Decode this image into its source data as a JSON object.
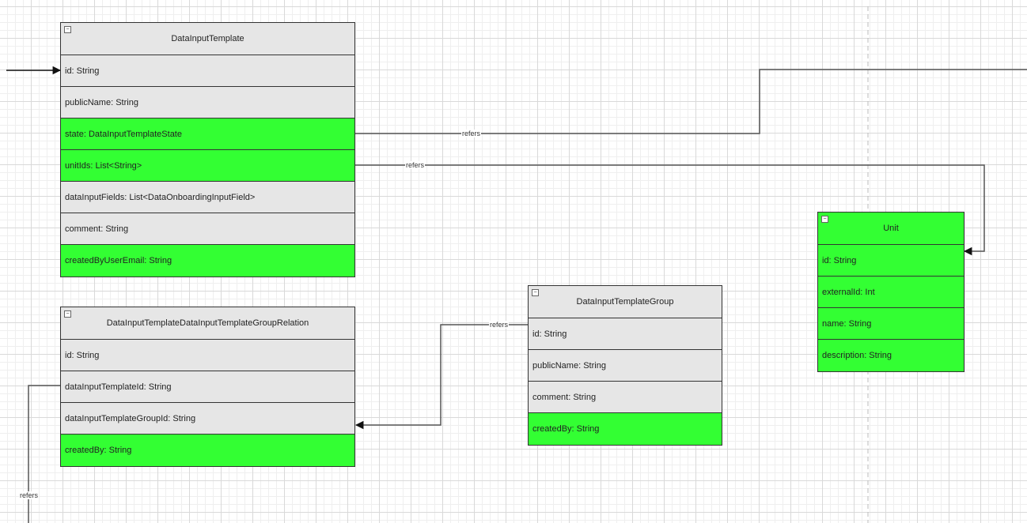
{
  "colors": {
    "highlight": "#33ff33",
    "default": "#e6e6e6",
    "line": "#555555"
  },
  "entities": {
    "template": {
      "title": "DataInputTemplate",
      "fields": [
        "id: String",
        "publicName: String",
        "state: DataInputTemplateState",
        "unitIds: List<String>",
        "dataInputFields: List<DataOnboardingInputField>",
        "comment: String",
        "createdByUserEmail: String"
      ]
    },
    "relation": {
      "title": "DataInputTemplateDataInputTemplateGroupRelation",
      "fields": [
        "id: String",
        "dataInputTemplateId: String",
        "dataInputTemplateGroupId: String",
        "createdBy: String"
      ]
    },
    "group": {
      "title": "DataInputTemplateGroup",
      "fields": [
        "id: String",
        "publicName: String",
        "comment: String",
        "createdBy: String"
      ]
    },
    "unit": {
      "title": "Unit",
      "fields": [
        "id: String",
        "externalId: Int",
        "name: String",
        "description: String"
      ]
    }
  },
  "edge_labels": {
    "state_refers": "refers",
    "unitids_refers": "refers",
    "group_refers": "refers",
    "relation_refers": "refers"
  }
}
